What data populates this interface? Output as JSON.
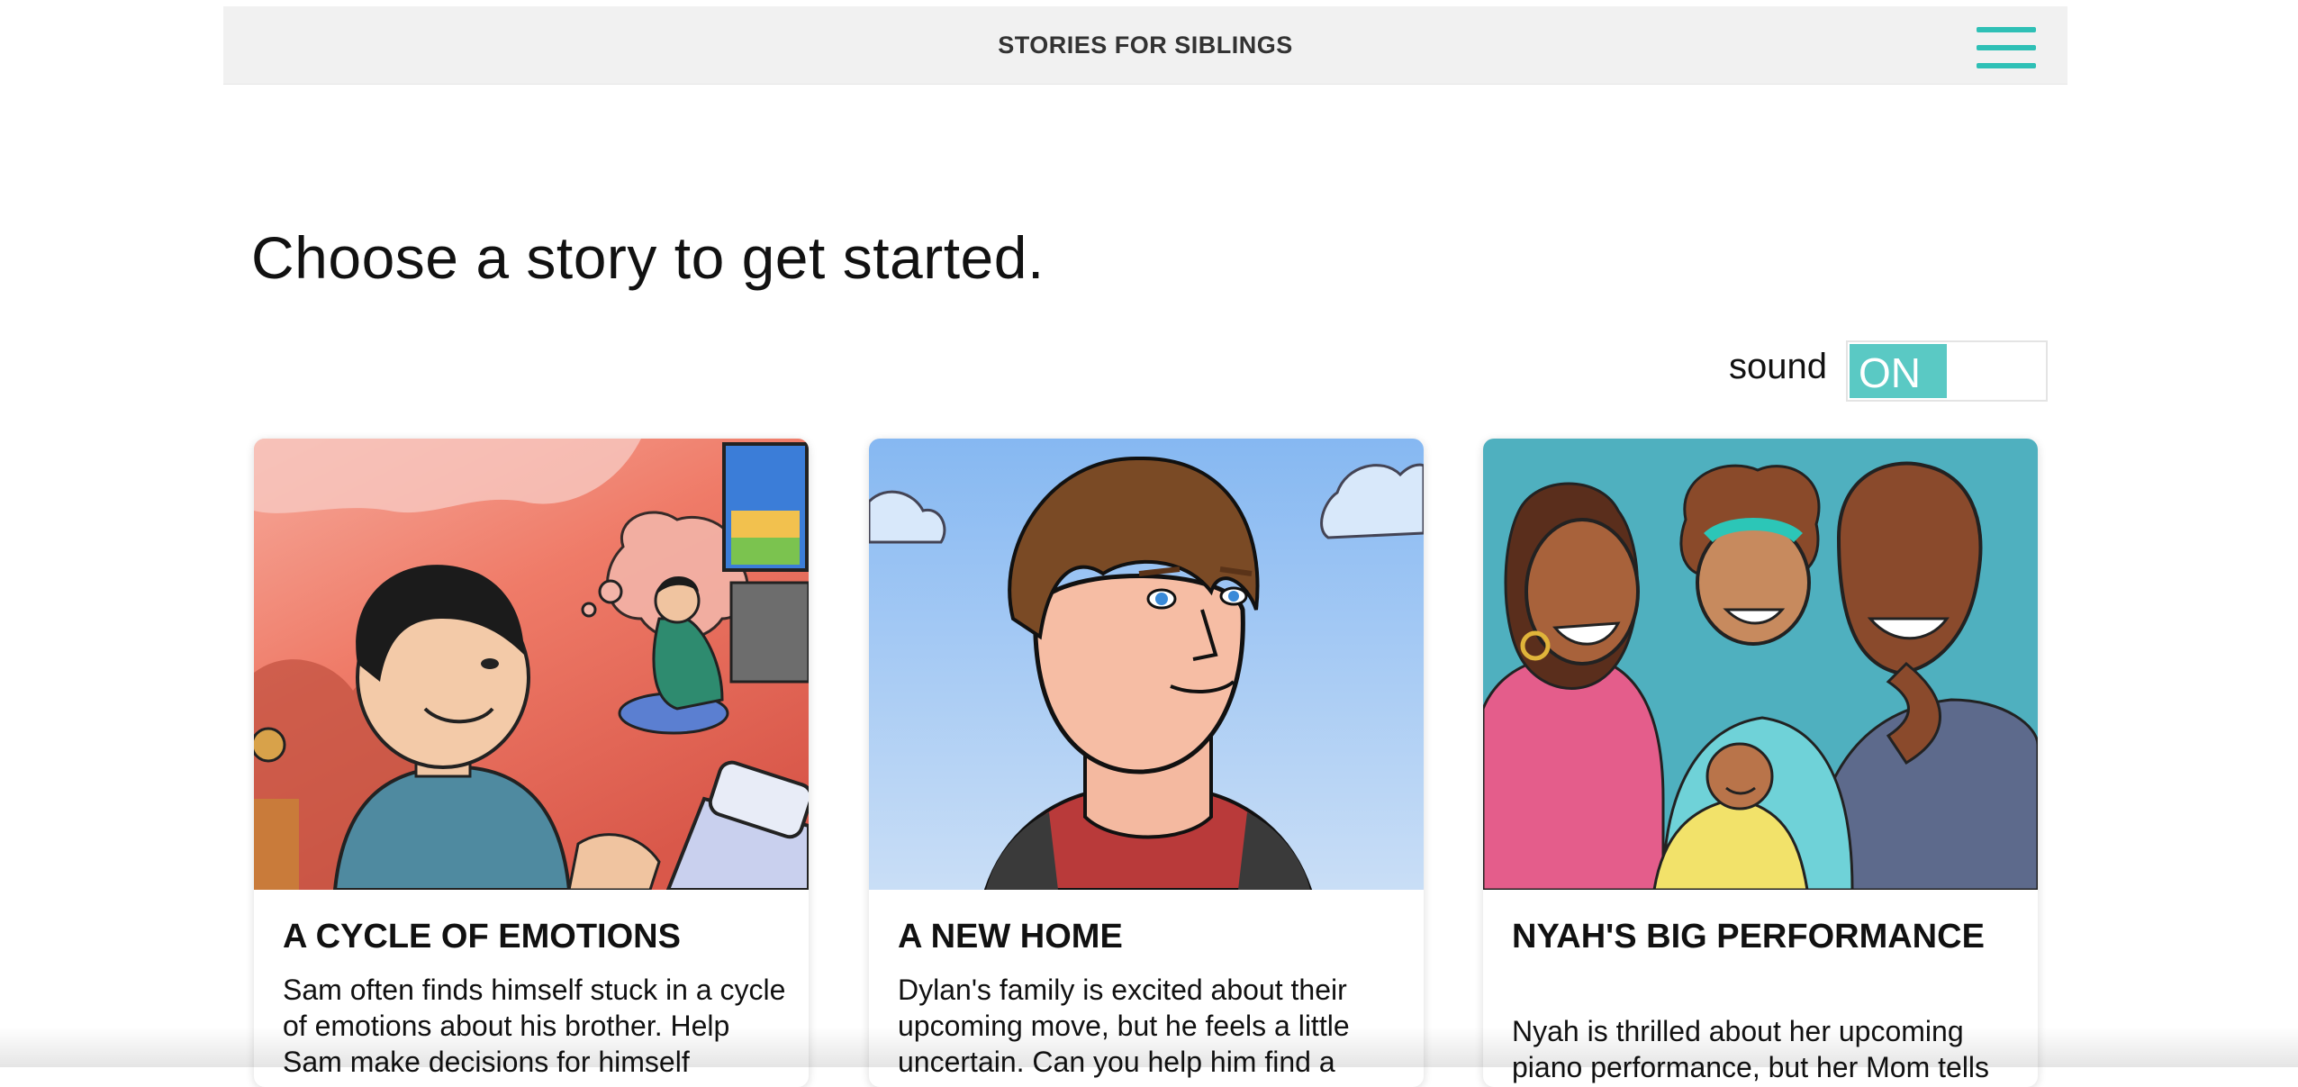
{
  "header": {
    "site_title": "STORIES FOR SIBLINGS",
    "menu_icon": "hamburger-menu-icon",
    "accent_color": "#2fc0b6"
  },
  "main": {
    "heading": "Choose a story to get started.",
    "sound": {
      "label": "sound",
      "state": "ON",
      "toggle_color": "#5ac9c4"
    }
  },
  "stories": [
    {
      "title": "A CYCLE OF EMOTIONS",
      "description": "Sam often finds himself stuck in a cycle of emotions about his brother. Help Sam make decisions for himself"
    },
    {
      "title": "A NEW HOME",
      "description": "Dylan's family is excited about their upcoming move, but he feels a little uncertain. Can you help him find a"
    },
    {
      "title": "NYAH'S BIG PERFORMANCE",
      "description": "Nyah is thrilled about her upcoming piano performance, but her Mom tells"
    }
  ]
}
